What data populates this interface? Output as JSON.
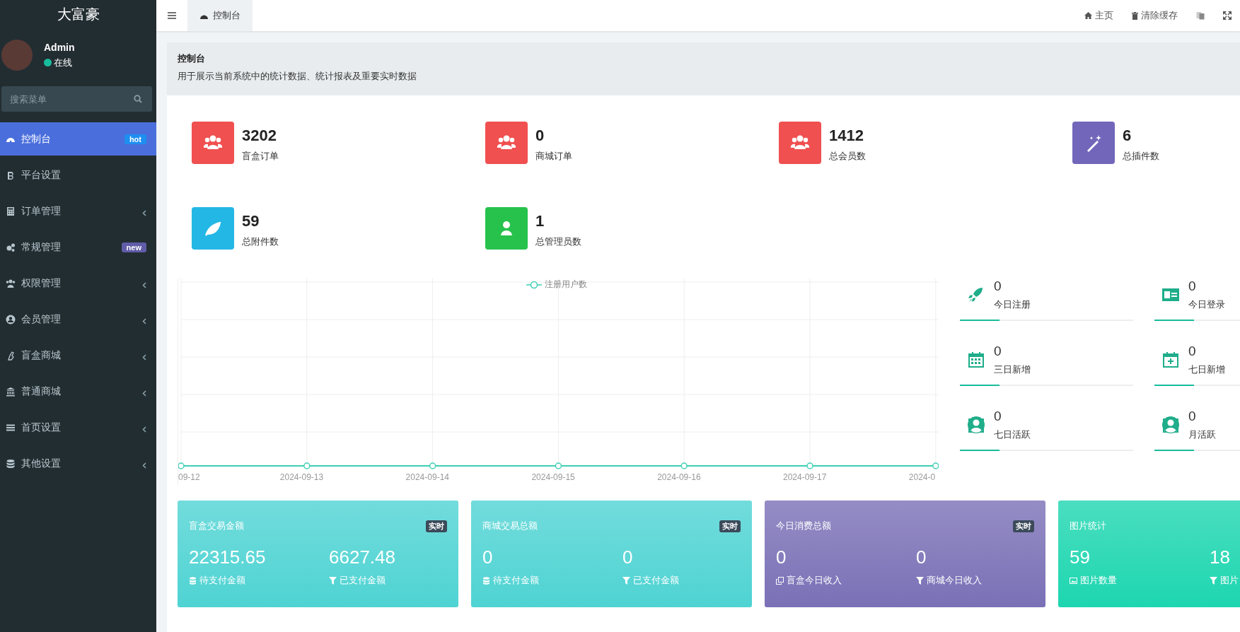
{
  "sidebar": {
    "brand": "大富豪",
    "user": {
      "name": "Admin",
      "status": "在线"
    },
    "search": {
      "placeholder": "搜索菜单"
    },
    "menu": [
      {
        "label": "控制台",
        "selected": true,
        "has_children": false,
        "badge": {
          "text": "hot",
          "color": "#1e8ef0"
        }
      },
      {
        "label": "平台设置",
        "selected": false,
        "has_children": false
      },
      {
        "label": "订单管理",
        "selected": false,
        "has_children": true
      },
      {
        "label": "常规管理",
        "selected": false,
        "has_children": false,
        "badge": {
          "text": "new",
          "color": "#605ca8"
        }
      },
      {
        "label": "权限管理",
        "selected": false,
        "has_children": true
      },
      {
        "label": "会员管理",
        "selected": false,
        "has_children": true
      },
      {
        "label": "盲盒商城",
        "selected": false,
        "has_children": true
      },
      {
        "label": "普通商城",
        "selected": false,
        "has_children": true
      },
      {
        "label": "首页设置",
        "selected": false,
        "has_children": true
      },
      {
        "label": "其他设置",
        "selected": false,
        "has_children": true
      }
    ]
  },
  "header": {
    "tabs": [
      {
        "label": "控制台",
        "selected": true
      }
    ],
    "links": [
      "主页",
      "清除缓存"
    ]
  },
  "page_header": {
    "title": "控制台",
    "description": "用于展示当前系统中的统计数据、统计报表及重要实时数据"
  },
  "stats": [
    {
      "value": "3202",
      "label": "盲盒订单",
      "color": "#f05050"
    },
    {
      "value": "0",
      "label": "商城订单",
      "color": "#f05050"
    },
    {
      "value": "1412",
      "label": "总会员数",
      "color": "#f05050"
    },
    {
      "value": "6",
      "label": "总插件数",
      "color": "#7266ba"
    },
    {
      "value": "59",
      "label": "总附件数",
      "color": "#23b7e5"
    },
    {
      "value": "1",
      "label": "总管理员数",
      "color": "#27c24c"
    }
  ],
  "chart": {
    "legend": "注册用户数",
    "x_labels": [
      "09-12",
      "2024-09-13",
      "2024-09-14",
      "2024-09-15",
      "2024-09-16",
      "2024-09-17",
      "2024-0"
    ]
  },
  "mini_stats": [
    {
      "value": "0",
      "label": "今日注册"
    },
    {
      "value": "0",
      "label": "今日登录"
    },
    {
      "value": "0",
      "label": "三日新增"
    },
    {
      "value": "0",
      "label": "七日新增"
    },
    {
      "value": "0",
      "label": "七日活跃"
    },
    {
      "value": "0",
      "label": "月活跃"
    }
  ],
  "cards": [
    {
      "title": "盲盒交易金额",
      "badge": "实时",
      "color": "#4fd3d3",
      "metrics": [
        {
          "value": "22315.65",
          "label": "待支付金额"
        },
        {
          "value": "6627.48",
          "label": "已支付金额"
        }
      ]
    },
    {
      "title": "商城交易总额",
      "badge": "实时",
      "color": "#4fd3d3",
      "metrics": [
        {
          "value": "0",
          "label": "待支付金额"
        },
        {
          "value": "0",
          "label": "已支付金额"
        }
      ]
    },
    {
      "title": "今日消费总额",
      "badge": "实时",
      "color": "#7a70b6",
      "metrics": [
        {
          "value": "0",
          "label": "盲盒今日收入"
        },
        {
          "value": "0",
          "label": "商城今日收入"
        }
      ]
    },
    {
      "title": "图片统计",
      "color": "#1dd6b0",
      "metrics": [
        {
          "value": "59",
          "label": "图片数量"
        },
        {
          "value": "18",
          "label": "图片"
        }
      ]
    }
  ]
}
